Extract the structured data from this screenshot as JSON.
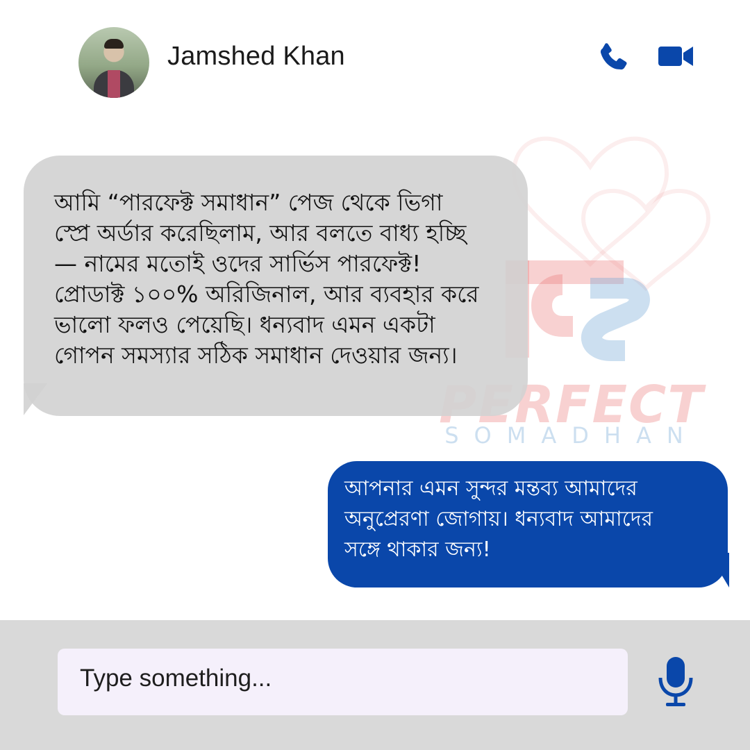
{
  "header": {
    "contact_name": "Jamshed Khan",
    "avatar": "contact-profile-photo",
    "actions": [
      {
        "icon": "phone-icon"
      },
      {
        "icon": "video-camera-icon"
      }
    ]
  },
  "watermark": {
    "brand_line1": "PERFECT",
    "brand_line2": "SOMADHAN",
    "colors": {
      "red": "#e87070",
      "blue": "#78aad7"
    }
  },
  "messages": [
    {
      "direction": "incoming",
      "text": "আমি “পারফেক্ট সমাধান” পেজ থেকে ভিগা\nস্প্রে অর্ডার করেছিলাম, আর বলতে বাধ্য হচ্ছি\n— নামের মতোই ওদের সার্ভিস পারফেক্ট!\nপ্রোডাক্ট ১০০% অরিজিনাল, আর ব্যবহার করে\nভালো ফলও পেয়েছি। ধন্যবাদ এমন একটা\nগোপন সমস্যার সঠিক সমাধান দেওয়ার জন্য।",
      "bubble_color": "#d2d2d2"
    },
    {
      "direction": "outgoing",
      "text": "আপনার এমন সুন্দর মন্তব্য আমাদের\nঅনুপ্রেরণা জোগায়। ধন্যবাদ আমাদের\nসঙ্গে থাকার জন্য!",
      "bubble_color": "#0a47aa"
    }
  ],
  "composer": {
    "placeholder": "Type something...",
    "mic_icon": "microphone-icon"
  },
  "colors": {
    "accent": "#0a47aa",
    "composer_bar": "#d9d9d9",
    "input_bg": "#f5f0fb"
  }
}
